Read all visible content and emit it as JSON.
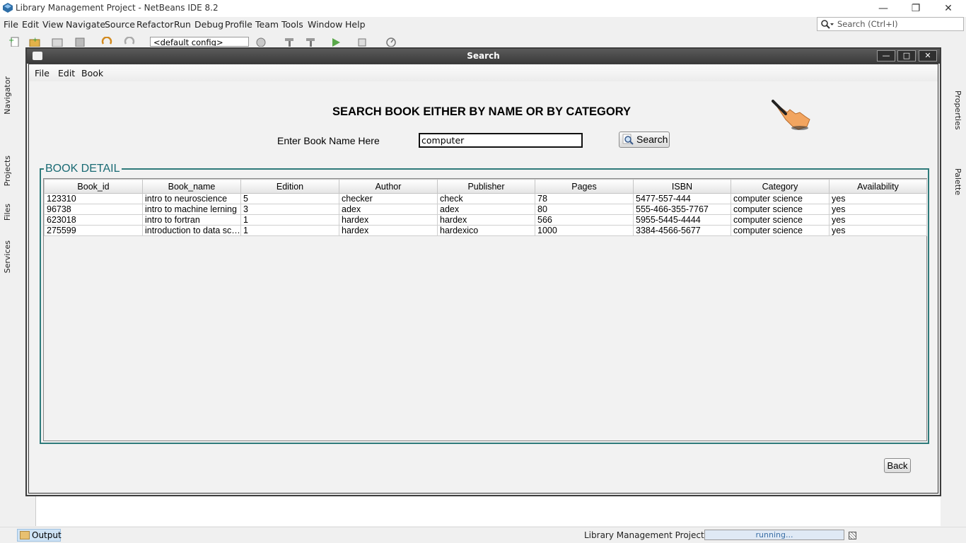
{
  "ide": {
    "title": "Library Management Project - NetBeans IDE 8.2",
    "menu": [
      "File",
      "Edit",
      "View",
      "Navigate",
      "Source",
      "Refactor",
      "Run",
      "Debug",
      "Profile",
      "Team",
      "Tools",
      "Window",
      "Help"
    ],
    "search_placeholder": "Search (Ctrl+I)",
    "config": "<default config>",
    "left_tabs": [
      "Navigator",
      "Projects",
      "Files",
      "Services"
    ],
    "right_tabs": [
      "Properties",
      "Palette"
    ],
    "status": {
      "output_tab": "Output",
      "run_label": "Library Management Project (run)",
      "progress_label": "running..."
    }
  },
  "dialog": {
    "title": "Search",
    "menu": [
      "File",
      "Edit",
      "Book"
    ],
    "heading": "SEARCH BOOK EITHER BY NAME OR BY CATEGORY",
    "name_label": "Enter Book Name Here",
    "name_value": "computer",
    "search_button": "Search",
    "book_detail_title": "BOOK DETAIL",
    "back_button": "Back",
    "table": {
      "columns": [
        "Book_id",
        "Book_name",
        "Edition",
        "Author",
        "Publisher",
        "Pages",
        "ISBN",
        "Category",
        "Availability"
      ],
      "rows": [
        [
          "123310",
          "intro to neuroscience",
          "5",
          "checker",
          "check",
          "78",
          "5477-557-444",
          "computer science",
          "yes"
        ],
        [
          "96738",
          "intro to machine lerning",
          "3",
          "adex",
          "adex",
          "80",
          "555-466-355-7767",
          "computer science",
          "yes"
        ],
        [
          "623018",
          "intro to fortran",
          "1",
          "hardex",
          "hardex",
          "566",
          "5955-5445-4444",
          "computer science",
          "yes"
        ],
        [
          "275599",
          "introduction to data sci...",
          "1",
          "hardex",
          "hardexico",
          "1000",
          "3384-4566-5677",
          "computer science",
          "yes"
        ]
      ]
    }
  }
}
